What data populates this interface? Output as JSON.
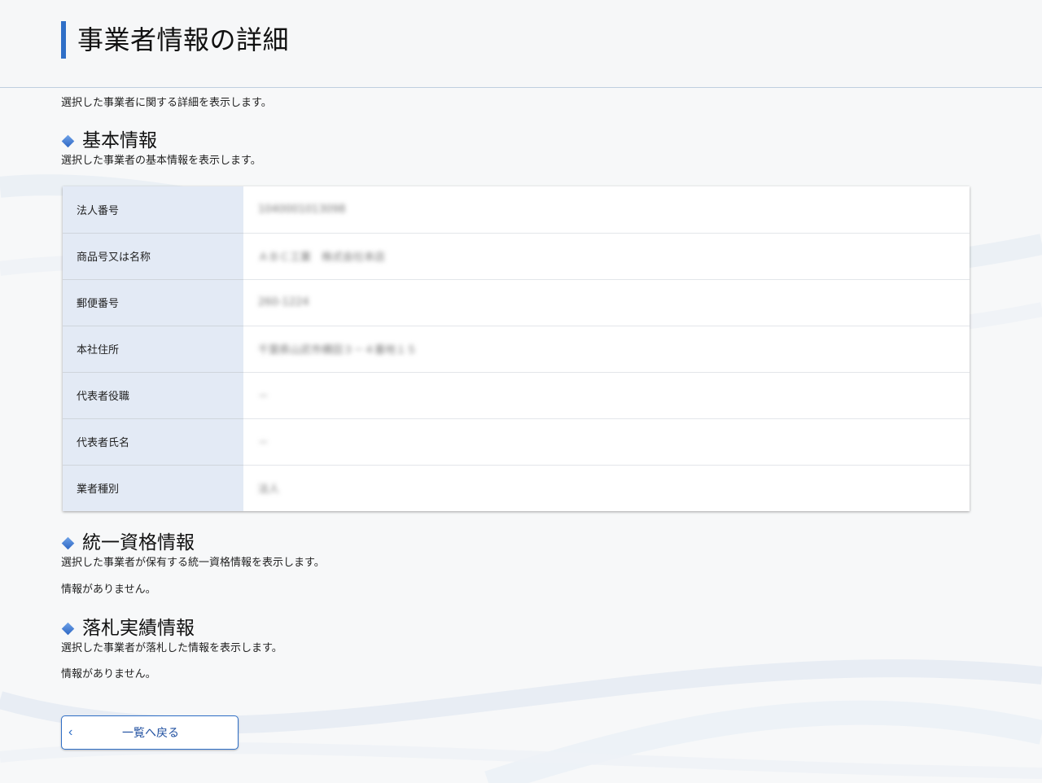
{
  "page": {
    "title": "事業者情報の詳細",
    "description": "選択した事業者に関する詳細を表示します。",
    "accent_color": "#2f6fc7"
  },
  "basic_info": {
    "title": "基本情報",
    "description": "選択した事業者の基本情報を表示します。",
    "rows": [
      {
        "label": "法人番号",
        "value": "1040001013098"
      },
      {
        "label": "商品号又は名称",
        "value": "ＡＢＣ工業　株式会社本店"
      },
      {
        "label": "郵便番号",
        "value": "260-1224"
      },
      {
        "label": "本社住所",
        "value": "千葉県山武市横田３－４番地１５"
      },
      {
        "label": "代表者役職",
        "value": "－"
      },
      {
        "label": "代表者氏名",
        "value": "－"
      },
      {
        "label": "業者種別",
        "value": "法人"
      }
    ]
  },
  "qualification_info": {
    "title": "統一資格情報",
    "description": "選択した事業者が保有する統一資格情報を表示します。",
    "empty_message": "情報がありません。"
  },
  "award_info": {
    "title": "落札実績情報",
    "description": "選択した事業者が落札した情報を表示します。",
    "empty_message": "情報がありません。"
  },
  "back_button": {
    "label": "一覧へ戻る",
    "icon": "chevron-left-icon"
  }
}
